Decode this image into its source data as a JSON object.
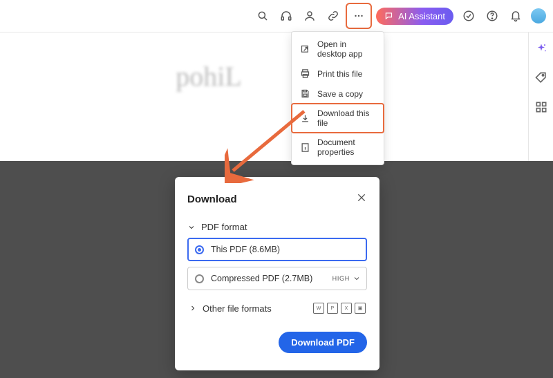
{
  "topbar": {
    "ai_label": "AI Assistant"
  },
  "menu": {
    "items": [
      {
        "label": "Open in desktop app"
      },
      {
        "label": "Print this file"
      },
      {
        "label": "Save a copy"
      },
      {
        "label": "Download this file"
      },
      {
        "label": "Document properties"
      }
    ]
  },
  "dialog": {
    "title": "Download",
    "section_pdf": "PDF format",
    "opt_this": "This PDF (8.6MB)",
    "opt_compressed": "Compressed PDF (2.7MB)",
    "quality": "HIGH",
    "section_other": "Other file formats",
    "button": "Download PDF"
  },
  "doc": {
    "signature": "pohiL"
  }
}
